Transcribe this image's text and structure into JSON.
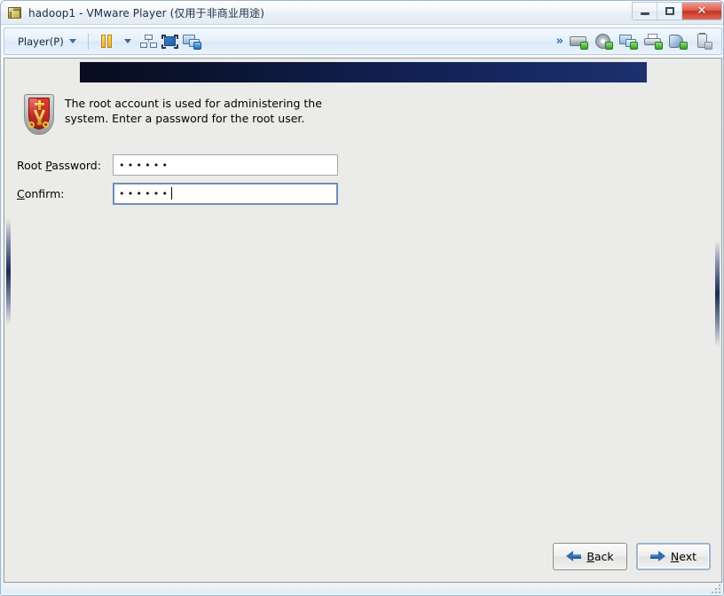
{
  "window": {
    "title": "hadoop1 - VMware Player (仅用于非商业用途)",
    "icon": "vmware-player-icon",
    "controls": {
      "minimize": "–",
      "maximize": "□",
      "close": "✕"
    }
  },
  "toolbar": {
    "player_menu_label": "Player(P)",
    "left_icons": [
      {
        "name": "pause-vm-icon",
        "label": "Pause"
      },
      {
        "name": "unity-mode-icon",
        "label": "Unity"
      },
      {
        "name": "fullscreen-icon",
        "label": "Enter Full Screen"
      },
      {
        "name": "vm-info-icon",
        "label": "Virtual Machine Settings"
      }
    ],
    "overflow_glyph": "»",
    "right_icons": [
      {
        "name": "hard-disk-icon",
        "label": "Hard Disk"
      },
      {
        "name": "cd-dvd-icon",
        "label": "CD/DVD"
      },
      {
        "name": "network-adapter-icon",
        "label": "Network Adapter"
      },
      {
        "name": "printer-icon",
        "label": "Printer"
      },
      {
        "name": "sound-card-icon",
        "label": "Sound Card"
      },
      {
        "name": "usb-device-icon",
        "label": "USB Device"
      }
    ]
  },
  "installer": {
    "banner_gradient_from": "#070d1e",
    "banner_gradient_to": "#1d3170",
    "root_icon": "root-password-shield-icon",
    "description": "The root account is used for administering the system.  Enter a password for the root user.",
    "fields": [
      {
        "label_prefix": "Root ",
        "label_mnemonic": "P",
        "label_suffix": "assword:",
        "value": "••••••",
        "placeholder": "",
        "focused": false
      },
      {
        "label_prefix": "",
        "label_mnemonic": "C",
        "label_suffix": "onfirm:",
        "value": "••••••",
        "placeholder": "",
        "focused": true
      }
    ],
    "buttons": {
      "back": {
        "mnemonic": "B",
        "suffix": "ack",
        "arrow": "left-arrow-icon",
        "focused": false
      },
      "next": {
        "mnemonic": "N",
        "suffix": "ext",
        "arrow": "right-arrow-icon",
        "focused": true
      }
    }
  }
}
